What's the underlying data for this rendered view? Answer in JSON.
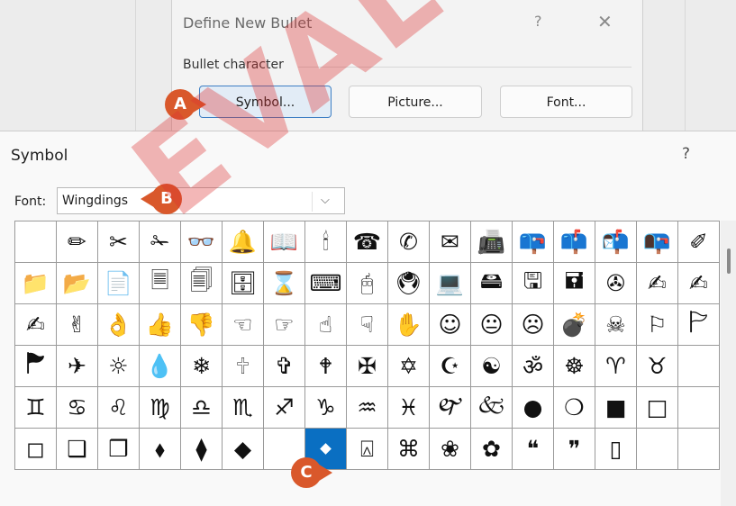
{
  "define_new_bullet": {
    "title": "Define New Bullet",
    "help": "?",
    "close": "✕",
    "group_label": "Bullet character",
    "buttons": [
      "Symbol...",
      "Picture...",
      "Font..."
    ]
  },
  "symbol_dialog": {
    "title": "Symbol",
    "help": "?",
    "font_label": "Font:",
    "font_value": "Wingdings",
    "dropdown_glyph": "⌵"
  },
  "callouts": [
    "A",
    "B",
    "C"
  ],
  "grid": {
    "selected_row": 5,
    "selected_col": 7,
    "rows": [
      [
        "",
        "✏",
        "✂",
        "✁",
        "👓",
        "🔔",
        "📖",
        "🕯",
        "☎",
        "✆",
        "✉",
        "📠",
        "📪",
        "📫",
        "📬",
        "📭",
        "✐"
      ],
      [
        "📁",
        "📂",
        "📄",
        "🗏",
        "🗐",
        "🗄",
        "⌛",
        "⌨",
        "🖰",
        "🖲",
        "💻",
        "🖴",
        "🖫",
        "🖬",
        "✇",
        "✍",
        "✍"
      ],
      [
        "✍",
        "✌",
        "👌",
        "👍",
        "👎",
        "☜",
        "☞",
        "☝",
        "☟",
        "✋",
        "☺",
        "😐",
        "☹",
        "💣",
        "☠",
        "⚐",
        "🏱"
      ],
      [
        "🏲",
        "✈",
        "☼",
        "💧",
        "❄",
        "🕆",
        "✞",
        "🕈",
        "✠",
        "✡",
        "☪",
        "☯",
        "ॐ",
        "☸",
        "♈",
        "♉",
        ""
      ],
      [
        "♊",
        "♋",
        "♌",
        "♍",
        "♎",
        "♏",
        "♐",
        "♑",
        "♒",
        "♓",
        "🙰",
        "🙵",
        "●",
        "❍",
        "■",
        "□",
        ""
      ],
      [
        "◻",
        "❑",
        "❒",
        "⬧",
        "⧫",
        "◆",
        "",
        "⌧",
        "⍓",
        "⌘",
        "❀",
        "✿",
        "❝",
        "❞",
        "▯",
        "",
        ""
      ]
    ]
  },
  "watermark": "EVALUATION",
  "colors": {
    "accent": "#0a6fc2",
    "callout": "#d9582b",
    "watermark": "#dc3232"
  }
}
